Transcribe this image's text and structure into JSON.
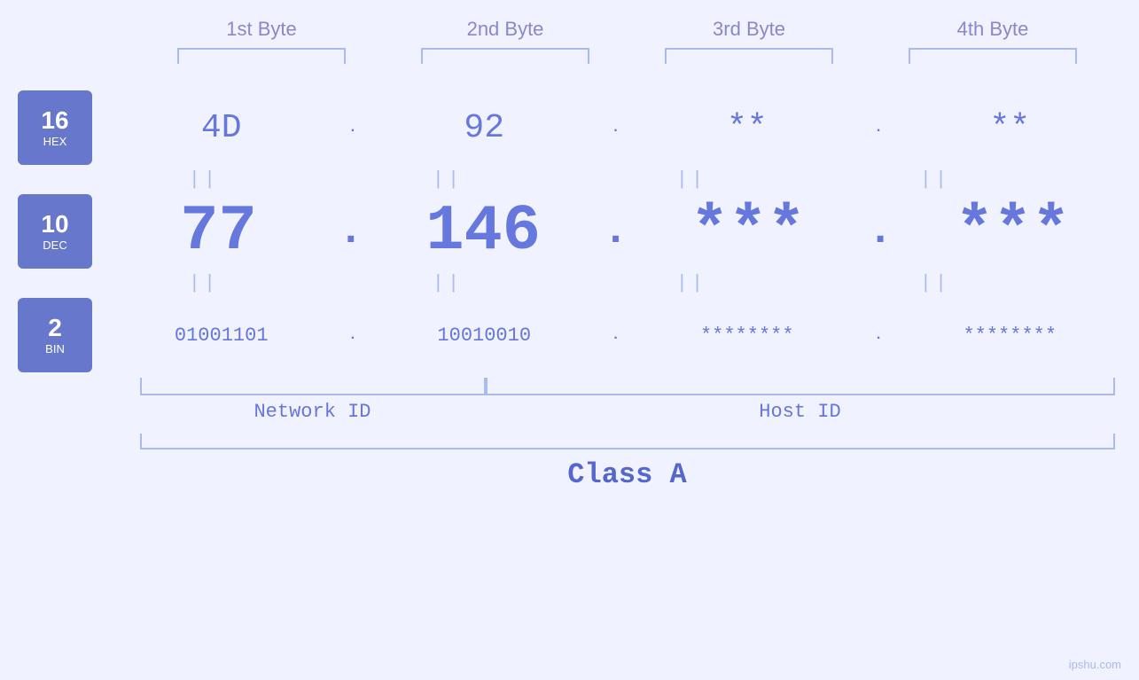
{
  "byteHeaders": [
    "1st Byte",
    "2nd Byte",
    "3rd Byte",
    "4th Byte"
  ],
  "badges": [
    {
      "num": "16",
      "base": "HEX"
    },
    {
      "num": "10",
      "base": "DEC"
    },
    {
      "num": "2",
      "base": "BIN"
    }
  ],
  "hexValues": [
    "4D",
    "92",
    "**",
    "**"
  ],
  "decValues": [
    "77",
    "146",
    "***",
    "***"
  ],
  "binValues": [
    "01001101",
    "10010010",
    "********",
    "********"
  ],
  "equalsSign": "||",
  "networkLabel": "Network ID",
  "hostLabel": "Host ID",
  "classLabel": "Class A",
  "watermark": "ipshu.com"
}
